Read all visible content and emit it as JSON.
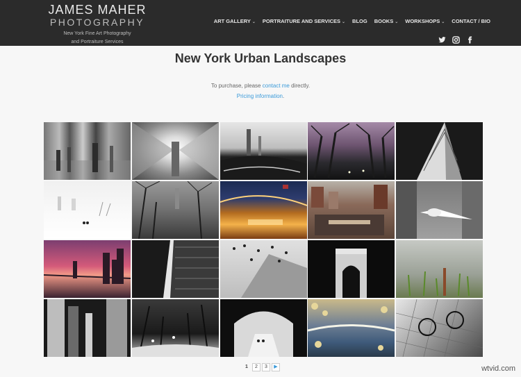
{
  "brand": {
    "name": "JAMES MAHER",
    "sub": "PHOTOGRAPHY",
    "tagline1": "New York Fine Art Photography",
    "tagline2": "and Portraiture Services"
  },
  "nav": [
    {
      "label": "ART GALLERY",
      "dropdown": true
    },
    {
      "label": "PORTRAITURE AND SERVICES",
      "dropdown": true
    },
    {
      "label": "BLOG",
      "dropdown": false
    },
    {
      "label": "BOOKS",
      "dropdown": true
    },
    {
      "label": "WORKSHOPS",
      "dropdown": true
    },
    {
      "label": "CONTACT / BIO",
      "dropdown": false
    }
  ],
  "social": [
    "twitter-icon",
    "instagram-icon",
    "facebook-icon"
  ],
  "page": {
    "title": "New York Urban Landscapes",
    "purchase_prefix": "To purchase, please",
    "purchase_link": "contact me",
    "purchase_suffix": "directly.",
    "pricing_link": "Pricing information",
    "pricing_suffix": "."
  },
  "pagination": {
    "pages": [
      "1",
      "2",
      "3"
    ],
    "current": "1",
    "next": "▶"
  },
  "watermark": "wtvid.com",
  "colors": {
    "header_bg": "#2b2b2b",
    "link": "#3a9ad9",
    "page_bg": "#f7f7f7"
  }
}
